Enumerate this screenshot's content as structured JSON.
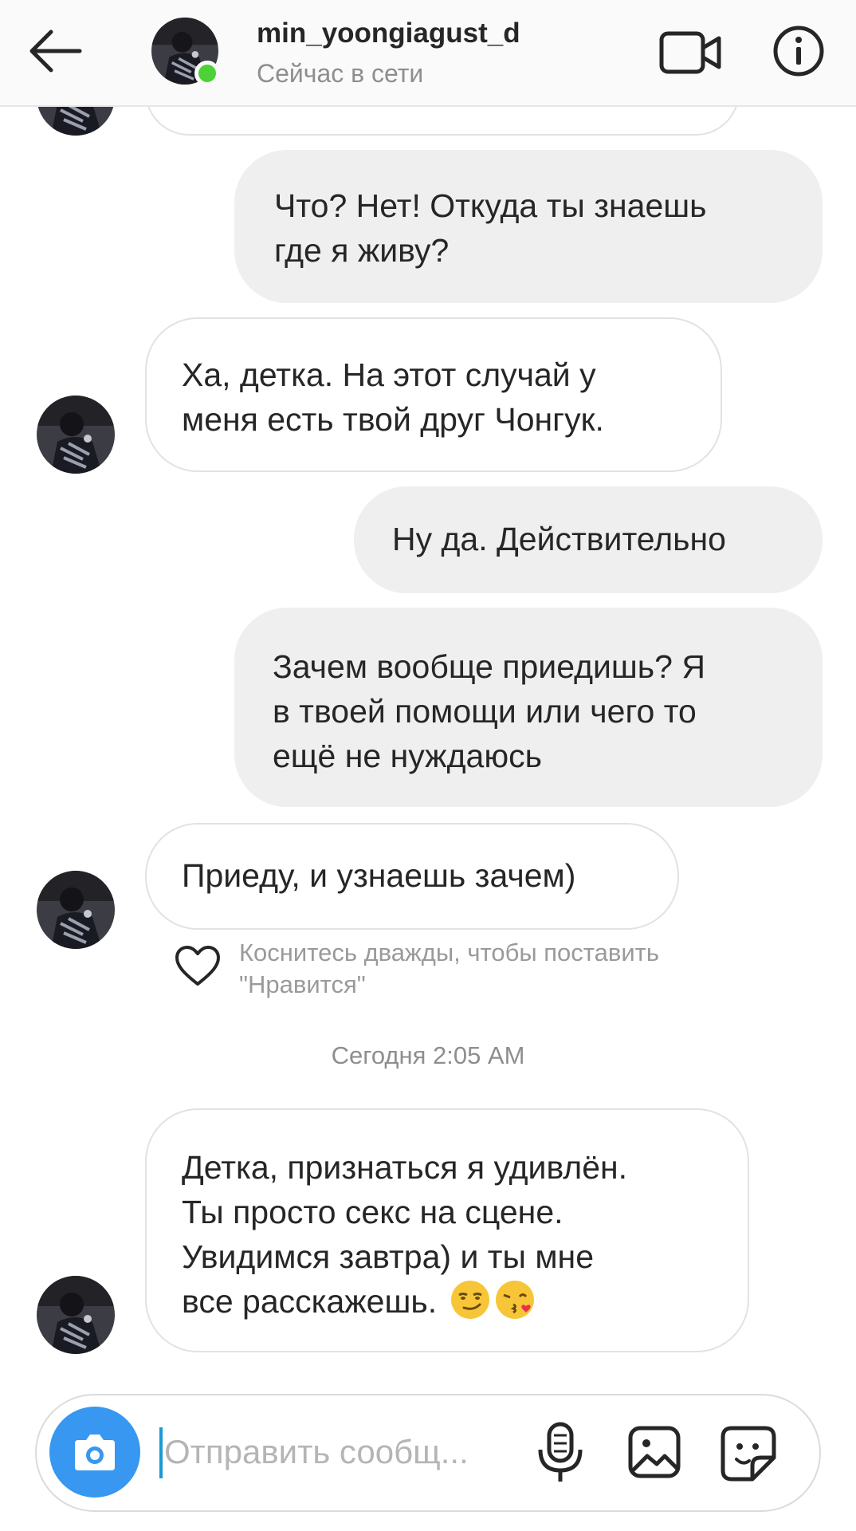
{
  "header": {
    "username": "min_yoongiagust_d",
    "status": "Сейчас в сети",
    "icons": {
      "back": "arrow-left-icon",
      "video": "video-camera-icon",
      "info": "info-icon"
    }
  },
  "messages": [
    {
      "side": "in",
      "lines": []
    },
    {
      "side": "out",
      "lines": [
        "Что? Нет! Откуда ты знаешь",
        "где я живу?"
      ]
    },
    {
      "side": "in",
      "lines": [
        "Ха, детка. На этот случай у",
        "меня есть твой друг Чонгук."
      ]
    },
    {
      "side": "out",
      "lines": [
        "Ну да. Действительно"
      ]
    },
    {
      "side": "out",
      "lines": [
        "Зачем вообще приедишь? Я",
        "в твоей помощи или чего то",
        "ещё не нуждаюсь"
      ]
    },
    {
      "side": "in",
      "lines": [
        "Приеду, и узнаешь зачем)"
      ]
    },
    {
      "side": "in",
      "lines": [
        "Детка, признаться я удивлён.",
        "Ты просто секс на сцене.",
        "Увидимся завтра) и ты мне",
        "все расскажешь."
      ],
      "emojis": [
        "smirk-emoji",
        "kiss-heart-emoji"
      ]
    }
  ],
  "like_hint": {
    "line1": "Коснитесь дважды, чтобы поставить",
    "line2": "\"Нравится\""
  },
  "timestamp": "Сегодня 2:05 AM",
  "composer": {
    "placeholder": "Отправить сообщ...",
    "icons": [
      "camera-icon",
      "microphone-icon",
      "gallery-icon",
      "sticker-icon"
    ]
  },
  "colors": {
    "accent": "#3897f0",
    "online": "#4cd137",
    "outgoing_bubble": "#efefef"
  }
}
